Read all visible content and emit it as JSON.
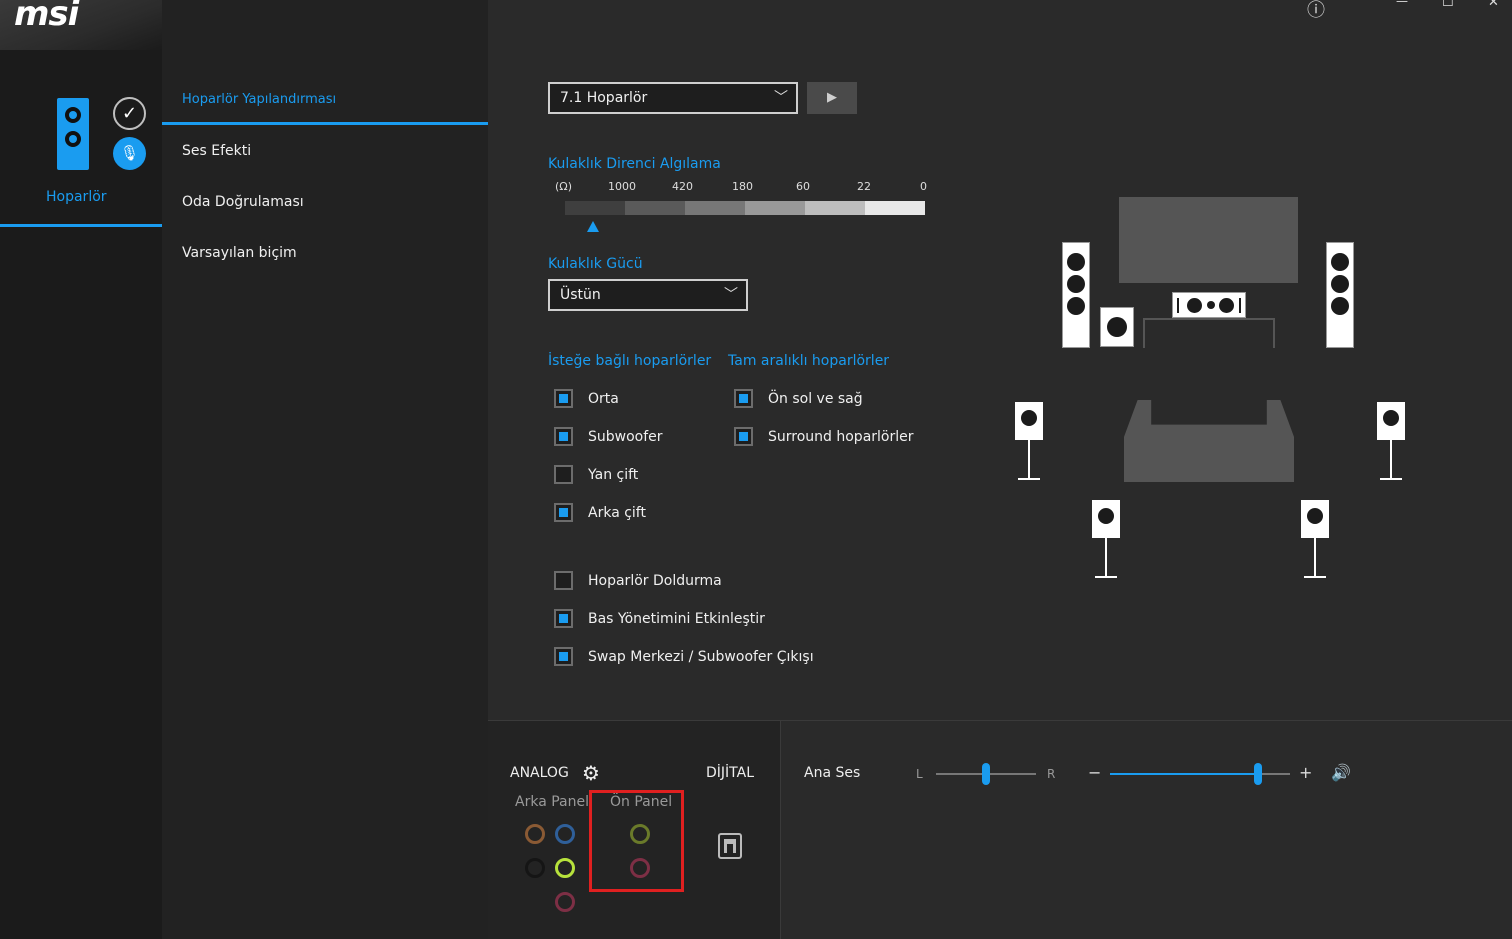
{
  "app": {
    "brand": "msi"
  },
  "window_controls": {
    "info": "ⓘ",
    "minimize": "—",
    "maximize": "☐",
    "close": "✕"
  },
  "left_nav": {
    "speaker_label": "Hoparlör"
  },
  "submenu": {
    "items": [
      "Hoparlör Yapılandırması",
      "Ses Efekti",
      "Oda Doğrulaması",
      "Varsayılan biçim"
    ],
    "active_index": 0
  },
  "config": {
    "speaker_select": "7.1 Hoparlör",
    "play_icon": "play-icon"
  },
  "impedance": {
    "title": "Kulaklık Direnci Algılama",
    "unit": "(Ω)",
    "ticks": [
      "1000",
      "420",
      "180",
      "60",
      "22",
      "0"
    ],
    "colors": [
      "#3f3f3f",
      "#5a5a5a",
      "#777777",
      "#999999",
      "#bdbdbd",
      "#e8e8e8"
    ]
  },
  "headphone_power": {
    "title": "Kulaklık Gücü",
    "select": "Üstün"
  },
  "optional_speakers": {
    "title": "İsteğe bağlı hoparlörler",
    "items": [
      {
        "label": "Orta",
        "checked": true
      },
      {
        "label": "Subwoofer",
        "checked": true
      },
      {
        "label": "Yan çift",
        "checked": false
      },
      {
        "label": "Arka çift",
        "checked": true
      }
    ]
  },
  "full_range": {
    "title": "Tam aralıklı hoparlörler",
    "items": [
      {
        "label": "Ön sol ve sağ",
        "checked": true
      },
      {
        "label": "Surround hoparlörler",
        "checked": true
      }
    ]
  },
  "options": [
    {
      "label": "Hoparlör Doldurma",
      "checked": false
    },
    {
      "label": "Bas Yönetimini Etkinleştir",
      "checked": true
    },
    {
      "label": "Swap Merkezi / Subwoofer Çıkışı",
      "checked": true
    }
  ],
  "io": {
    "analog_label": "ANALOG",
    "digital_label": "DİJİTAL",
    "rear_panel_label": "Arka Panel",
    "front_panel_label": "Ön Panel",
    "highlight_color": "#e02020",
    "rear_jacks": [
      "#8a5a34",
      "#2f5f99",
      "#151515",
      "#b7e23c",
      "#7d2f45"
    ],
    "front_jacks": [
      "#6a7a2a",
      "#7d2f45"
    ]
  },
  "master": {
    "label": "Ana Ses",
    "balance_left": "L",
    "balance_right": "R",
    "vol_minus": "−",
    "vol_plus": "+",
    "balance_value": 0.5,
    "volume_value": 0.82
  }
}
